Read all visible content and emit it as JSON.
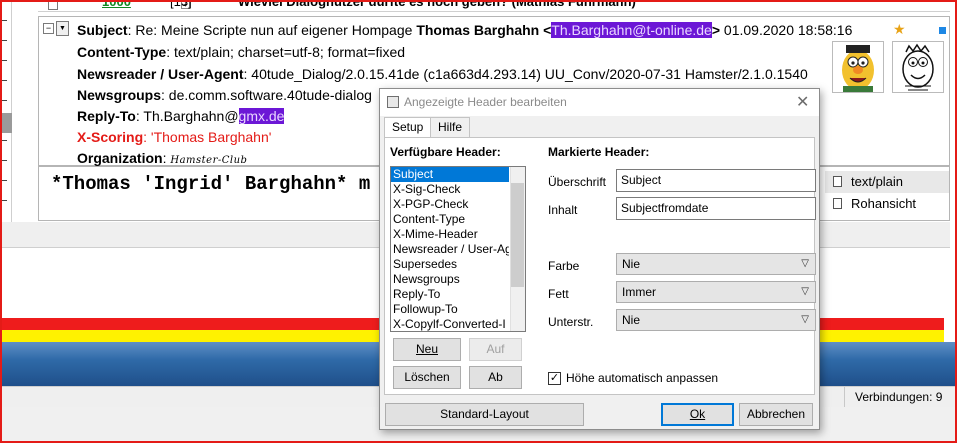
{
  "thread_row": {
    "count": "1000",
    "number": "[13]",
    "title": "Wieviel Dialognutzer dürfte es noch geben? (Mathias Fuhrmann)"
  },
  "header": {
    "subject_label": "Subject",
    "subject_value": ": Re: Meine Scripte nun auf eigener Hompage",
    "author_name": "Thomas Barghahn",
    "author_email": "Th.Barghahn@t-online.de",
    "date": "01.09.2020 18:58:16",
    "content_type_label": "Content-Type",
    "content_type_value": ": text/plain; charset=utf-8; format=fixed",
    "newsreader_label": "Newsreader / User-Agent",
    "newsreader_value": ": 40tude_Dialog/2.0.15.41de (c1a663d4.293.14) UU_Conv/2020-07-31 Hamster/2.1.0.1540",
    "newsgroups_label": "Newsgroups",
    "newsgroups_value": ": de.comm.software.40tude-dialog",
    "replyto_label": "Reply-To",
    "replyto_value": ": Th.Barghahn@",
    "replyto_domain": "gmx.de",
    "xscoring_label": "X-Scoring",
    "xscoring_value": ": 'Thomas Barghahn'",
    "organization_label": "Organization",
    "organization_value": "Hamster-Club"
  },
  "body": {
    "text": "*Thomas 'Ingrid' Barghahn* m"
  },
  "right_panel": {
    "items": [
      "text/plain",
      "Rohansicht"
    ]
  },
  "status": {
    "connections": "Verbindungen: 9"
  },
  "dialog": {
    "title": "Angezeigte Header bearbeiten",
    "tabs": [
      "Setup",
      "Hilfe"
    ],
    "available_label": "Verfügbare Header:",
    "available_items": [
      "Subject",
      "X-Sig-Check",
      "X-PGP-Check",
      "Content-Type",
      "X-Mime-Header",
      "Newsreader / User-Agent",
      "Supersedes",
      "Newsgroups",
      "Reply-To",
      "Followup-To",
      "X-Copylf-Converted-I"
    ],
    "marked_label": "Markierte Header:",
    "ueberschrift_label": "Überschrift",
    "ueberschrift_value": "Subject",
    "inhalt_label": "Inhalt",
    "inhalt_value": "Subjectfromdate",
    "farbe_label": "Farbe",
    "farbe_value": "Nie",
    "fett_label": "Fett",
    "fett_value": "Immer",
    "unterstr_label": "Unterstr.",
    "unterstr_value": "Nie",
    "autoheight_label": "Höhe automatisch anpassen",
    "autoheight_checked": true,
    "btn_neu": "Neu",
    "btn_auf": "Auf",
    "btn_loeschen": "Löschen",
    "btn_ab": "Ab",
    "btn_standard": "Standard-Layout",
    "btn_ok": "Ok",
    "btn_abbrechen": "Abbrechen"
  },
  "colors": {
    "frame": "#e41b17",
    "highlight": "#6c17d6",
    "scoring": "#e41b17",
    "selection": "#0078d7",
    "band_red": "#ee1c1c",
    "band_yellow": "#fff200"
  }
}
